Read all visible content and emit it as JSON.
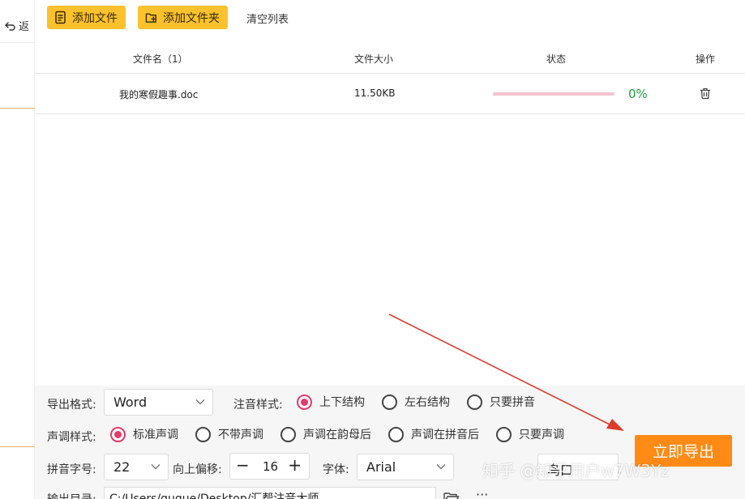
{
  "sidebar": {
    "back_label": "返"
  },
  "toolbar": {
    "add_file_label": "添加文件",
    "add_folder_label": "添加文件夹",
    "clear_list_label": "清空列表"
  },
  "table": {
    "headers": {
      "name": "文件名（1）",
      "size": "文件大小",
      "status": "状态",
      "action": "操作"
    },
    "rows": [
      {
        "name": "我的寒假趣事.doc",
        "size": "11.50KB",
        "progress_percent": 0,
        "progress_label": "0%"
      }
    ]
  },
  "settings": {
    "export_format": {
      "label": "导出格式:",
      "value": "Word"
    },
    "annotation_style": {
      "label": "注音样式:",
      "options": [
        "上下结构",
        "左右结构",
        "只要拼音"
      ],
      "selected": 0
    },
    "tone_style": {
      "label": "声调样式:",
      "options": [
        "标准声调",
        "不带声调",
        "声调在韵母后",
        "声调在拼音后",
        "只要声调"
      ],
      "selected": 0
    },
    "pinyin_size": {
      "label": "拼音字号:",
      "value": "22"
    },
    "offset": {
      "label": "向上偏移:",
      "value": "16",
      "minus": "−",
      "plus": "+"
    },
    "font": {
      "label": "字体:",
      "value": "Arial"
    },
    "color_partial": {
      "value": "鸟口"
    },
    "output_dir": {
      "label": "输出目录:",
      "value": "C:/Users/gugue/Desktop/汇帮注音大师",
      "more": "···"
    },
    "export_button": "立即导出"
  },
  "watermark": "知乎 @知乎用户w7W3Yz",
  "colors": {
    "accent_yellow": "#fcc12d",
    "export_orange": "#ff8a16",
    "radio_pink": "#e63a6a",
    "progress_green": "#1e9e3a",
    "arrow_red": "#e03a2a"
  }
}
